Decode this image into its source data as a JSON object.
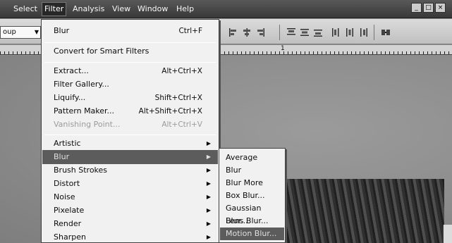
{
  "menubar": {
    "items": [
      "Select",
      "Filter",
      "Analysis",
      "View",
      "Window",
      "Help"
    ],
    "open_item": "Filter"
  },
  "options_bar": {
    "dropdown_value": "oup"
  },
  "ruler": {
    "visible_number": "1"
  },
  "filter_menu": {
    "last_filter": {
      "label": "Blur",
      "shortcut": "Ctrl+F"
    },
    "convert_smart": "Convert for Smart Filters",
    "extract": {
      "label": "Extract...",
      "shortcut": "Alt+Ctrl+X"
    },
    "filter_gallery": {
      "label": "Filter Gallery..."
    },
    "liquify": {
      "label": "Liquify...",
      "shortcut": "Shift+Ctrl+X"
    },
    "pattern_maker": {
      "label": "Pattern Maker...",
      "shortcut": "Alt+Shift+Ctrl+X"
    },
    "vanishing_point": {
      "label": "Vanishing Point...",
      "shortcut": "Alt+Ctrl+V"
    },
    "groups": [
      "Artistic",
      "Blur",
      "Brush Strokes",
      "Distort",
      "Noise",
      "Pixelate",
      "Render",
      "Sharpen"
    ],
    "highlighted_group": "Blur"
  },
  "blur_submenu": {
    "items": [
      "Average",
      "Blur",
      "Blur More",
      "Box Blur...",
      "Gaussian Blur...",
      "Lens Blur...",
      "Motion Blur..."
    ],
    "highlighted": "Motion Blur..."
  },
  "colors": {
    "menubar_bg": "#3c3c3c",
    "menu_bg": "#ececec",
    "highlight_bg": "#5e5e5e"
  }
}
